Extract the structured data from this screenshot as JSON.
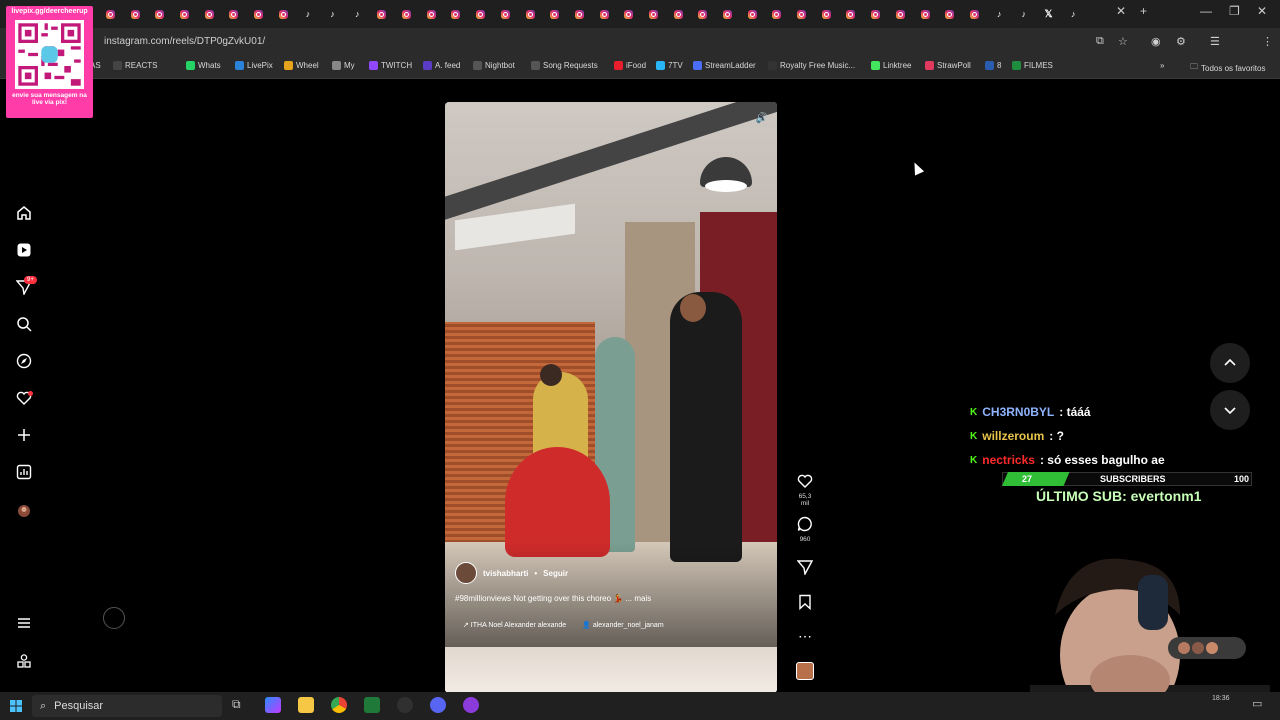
{
  "browser": {
    "url": "instagram.com/reels/DTP0gZvkU01/",
    "tab_icons": [
      "ig",
      "ig",
      "ig",
      "ig",
      "ig",
      "ig",
      "ig",
      "ig",
      "tt",
      "tt",
      "tt",
      "ig",
      "ig",
      "ig",
      "ig",
      "ig",
      "ig",
      "ig",
      "ig",
      "ig",
      "ig",
      "ig",
      "ig",
      "ig",
      "ig",
      "ig",
      "ig",
      "ig",
      "ig",
      "ig",
      "ig",
      "ig",
      "ig",
      "ig",
      "ig",
      "ig",
      "tt",
      "tt",
      "x",
      "tt"
    ],
    "new_tab_label": "+",
    "close_label": "✕",
    "bookmarks": [
      {
        "label": "REACTS",
        "color": "#444444"
      },
      {
        "label": "Whats",
        "color": "#25d366"
      },
      {
        "label": "LivePix",
        "color": "#2b82d9"
      },
      {
        "label": "Wheel",
        "color": "#e8a31c"
      },
      {
        "label": "My",
        "color": "#888888"
      },
      {
        "label": "TWITCH",
        "color": "#9146ff"
      },
      {
        "label": "A. feed",
        "color": "#5b3cc4"
      },
      {
        "label": "Nightbot",
        "color": "#555555"
      },
      {
        "label": "Song Requests",
        "color": "#555555"
      },
      {
        "label": "iFood",
        "color": "#ea1d2c"
      },
      {
        "label": "7TV",
        "color": "#29b6f6"
      },
      {
        "label": "StreamLadder",
        "color": "#4a6cf7"
      },
      {
        "label": "Royalty Free Music...",
        "color": "#333333"
      },
      {
        "label": "Linktree",
        "color": "#43e55e"
      },
      {
        "label": "StrawPoll",
        "color": "#e2395e"
      },
      {
        "label": "8",
        "color": "#2a5db0"
      },
      {
        "label": "FILMES",
        "color": "#1e8e3e"
      }
    ],
    "all_bookmarks": "Todos os favoritos",
    "bookmark_prefix": "AS"
  },
  "qr_overlay": {
    "top_text": "livepix.gg/deercheerup",
    "bottom_text": "envie sua mensagem na live via pix!"
  },
  "reel": {
    "author": "tvishabharti",
    "follow": "Seguir",
    "caption": "#98millionviews Not getting over this choreo 💃 ... mais",
    "audio": "↗ ITHA Noel Alexander  alexande",
    "tagged": "alexander_noel_janam",
    "likes": "65,3 mil",
    "comments": "960"
  },
  "chat": [
    {
      "user": "CH3RN0BYL",
      "user_color": "#8fb4ff",
      "message": ": tááá"
    },
    {
      "user": "willzeroum",
      "user_color": "#e8c44a",
      "message": ": ?"
    },
    {
      "user": "nectricks",
      "user_color": "#ff2b2b",
      "message": ": só esses bagulho ae"
    }
  ],
  "subs": {
    "current": "27",
    "label": "SUBSCRIBERS",
    "goal": "100",
    "progress": 0.27,
    "last_sub": "ÚLTIMO SUB: evertonm1"
  },
  "taskbar": {
    "search_placeholder": "Pesquisar",
    "time": "18:36"
  },
  "colors": {
    "qr_pink": "#ff3ca8",
    "sub_green": "#2fbe35",
    "kick_green": "#53fc18",
    "notif_red": "#ff3040"
  },
  "notif_badge": "9+"
}
